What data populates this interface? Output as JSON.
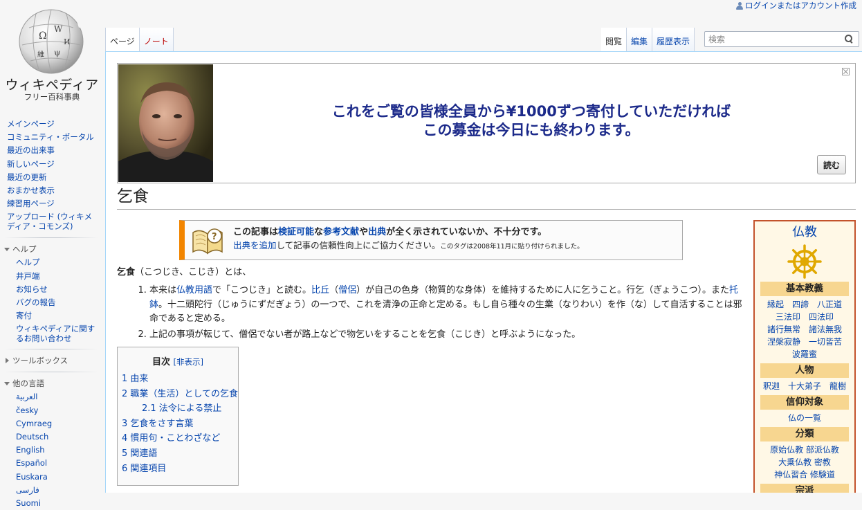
{
  "header": {
    "login": "ログインまたはアカウント作成",
    "logo_title": "ウィキペディア",
    "logo_subtitle": "フリー百科事典",
    "tabs_left": [
      "ページ",
      "ノート"
    ],
    "tabs_right": [
      "閲覧",
      "編集",
      "履歴表示"
    ],
    "search_placeholder": "検索"
  },
  "sidebar": {
    "main": [
      "メインページ",
      "コミュニティ・ポータル",
      "最近の出来事",
      "新しいページ",
      "最近の更新",
      "おまかせ表示",
      "練習用ページ",
      "アップロード (ウィキメディア・コモンズ)"
    ],
    "help_head": "ヘルプ",
    "help": [
      "ヘルプ",
      "井戸端",
      "お知らせ",
      "バグの報告",
      "寄付",
      "ウィキペディアに関するお問い合わせ"
    ],
    "toolbox_head": "ツールボックス",
    "lang_head": "他の言語",
    "languages": [
      "العربية",
      "česky",
      "Cymraeg",
      "Deutsch",
      "English",
      "Español",
      "Euskara",
      "فارسی",
      "Suomi"
    ]
  },
  "banner": {
    "line1": "これをご覧の皆様全員から¥1000ずつ寄付していただければ",
    "line2": "この募金は今日にも終わります。",
    "read_button": "読む"
  },
  "article": {
    "title": "乞食",
    "ambox": {
      "l1_a": "この記事は",
      "l1_link1": "検証可能",
      "l1_b": "な",
      "l1_link2": "参考文献",
      "l1_c": "や",
      "l1_link3": "出典",
      "l1_d": "が全く示されていないか、不十分です。",
      "l2_link": "出典を追加",
      "l2_text": "して記事の信頼性向上にご協力ください。",
      "l2_small": "このタグは2008年11月に貼り付けられました。"
    },
    "intro_bold": "乞食",
    "intro_rest": "（こつじき、こじき）とは、",
    "item1": {
      "a": "本来は",
      "link1": "仏教用語",
      "b": "で「こつじき」と読む。",
      "link2": "比丘",
      "c": "（",
      "link3": "僧侶",
      "d": "）が自己の色身（物質的な身体）を維持するために人に乞うこと。行乞（ぎょうこつ）。また",
      "link4": "托鉢",
      "e": "。十二頭陀行（じゅうにずだぎょう）の一つで、これを清浄の正命と定める。もし自ら種々の生業（なりわい）を作（な）して自活することは邪命であると定める。"
    },
    "item2": "上記の事項が転じて、僧侶でない者が路上などで物乞いをすることを乞食（こじき）と呼ぶようになった。"
  },
  "toc": {
    "head": "目次",
    "toggle": "[非表示]",
    "items": [
      "1 由来",
      "2 職業（生活）としての乞食",
      "2.1 法令による禁止",
      "3 乞食をさす言葉",
      "4 慣用句・ことわざなど",
      "5 関連語",
      "6 関連項目"
    ]
  },
  "infobox": {
    "title": "仏教",
    "sec1": "基本教義",
    "sec1_lines": [
      "縁起　四諦　八正道",
      "三法印　四法印",
      "諸行無常　諸法無我",
      "涅槃寂静　一切皆苦",
      "波羅蜜"
    ],
    "sec2": "人物",
    "sec2_lines": [
      "釈迦　十大弟子　龍樹"
    ],
    "sec3": "信仰対象",
    "sec3_lines": [
      "仏の一覧"
    ],
    "sec4": "分類",
    "sec4_lines": [
      "原始仏教 部派仏教",
      "大乗仏教 密教",
      "神仏習合 修験道"
    ],
    "sec5": "宗派"
  },
  "colors": {
    "link": "#0645ad",
    "new_link": "#ba0000",
    "banner_text": "#1c2a8a",
    "ambox_accent": "#f28500",
    "infobox_border": "#c3522b",
    "infobox_section": "#f7d690"
  }
}
